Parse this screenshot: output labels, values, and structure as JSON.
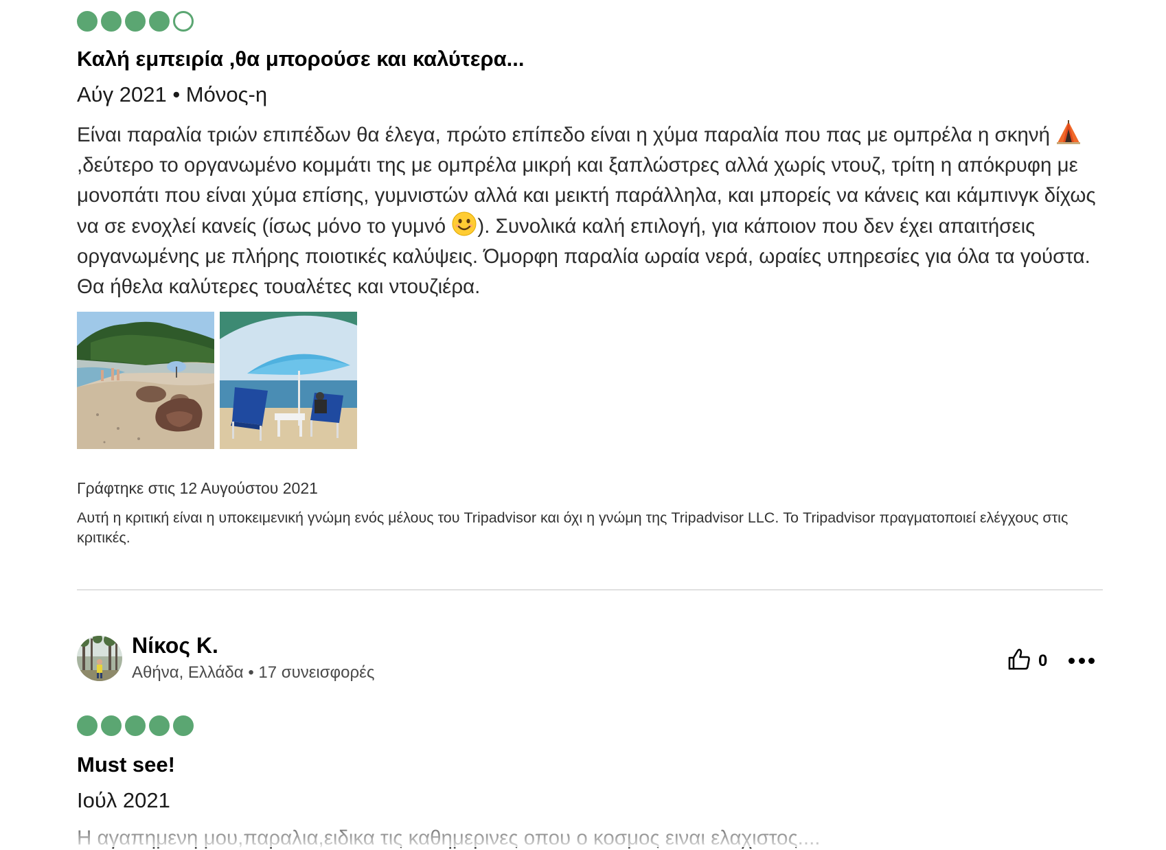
{
  "review1": {
    "rating": 4,
    "rating_max": 5,
    "title": "Καλή εμπειρία ,θα μπορούσε και καλύτερα...",
    "meta": "Αύγ 2021 • Μόνος-η",
    "text_parts": [
      "Είναι παραλία τριών επιπέδων θα έλεγα, πρώτο επίπεδο είναι η χύμα παραλία που πας με ομπρέλα η σκηνή ",
      " ,δεύτερο το οργανωμένο κομμάτι της με ομπρέλα μικρή και ξαπλώστρες αλλά χωρίς ντουζ, τρίτη η απόκρυφη με μονοπάτι που είναι χύμα επίσης, γυμνιστών αλλά και μεικτή παράλληλα, και μπορείς να κάνεις και κάμπινγκ δίχως να σε ενοχλεί κανείς (ίσως μόνο το γυμνό ",
      "). Συνολικά καλή επιλογή, για κάποιον που δεν έχει απαιτήσεις οργανωμένης με πλήρης ποιοτικές καλύψεις. Όμορφη παραλία ωραία νερά, ωραίες υπηρεσίες για όλα τα γούστα. Θα ήθελα καλύτερες τουαλέτες και ντουζιέρα."
    ],
    "emojis": [
      "camping-tent-icon",
      "smiling-face-icon"
    ],
    "photos": [
      "beach-rocks-photo",
      "beach-umbrella-photo"
    ],
    "written_date": "Γράφτηκε στις 12 Αυγούστου 2021",
    "disclaimer": "Αυτή η κριτική είναι η υποκειμενική γνώμη ενός μέλους του Tripadvisor και όχι η γνώμη της Tripadvisor LLC. Το Tripadvisor πραγματοποιεί ελέγχους στις κριτικές."
  },
  "review2": {
    "user_name": "Νίκος Κ.",
    "user_info": "Αθήνα, Ελλάδα • 17 συνεισφορές",
    "helpful_count": "0",
    "rating": 5,
    "rating_max": 5,
    "title": "Must see!",
    "meta": "Ιούλ 2021",
    "text": "Η αγαπημενη μου,παραλια,ειδικα τις καθημερινες οπου ο κοσμος ειναι ελαχιστος...."
  },
  "colors": {
    "bubble_green": "#5ba672",
    "divider": "#e0e0e0"
  },
  "icons": [
    "thumbs-up-icon",
    "more-options-icon"
  ]
}
